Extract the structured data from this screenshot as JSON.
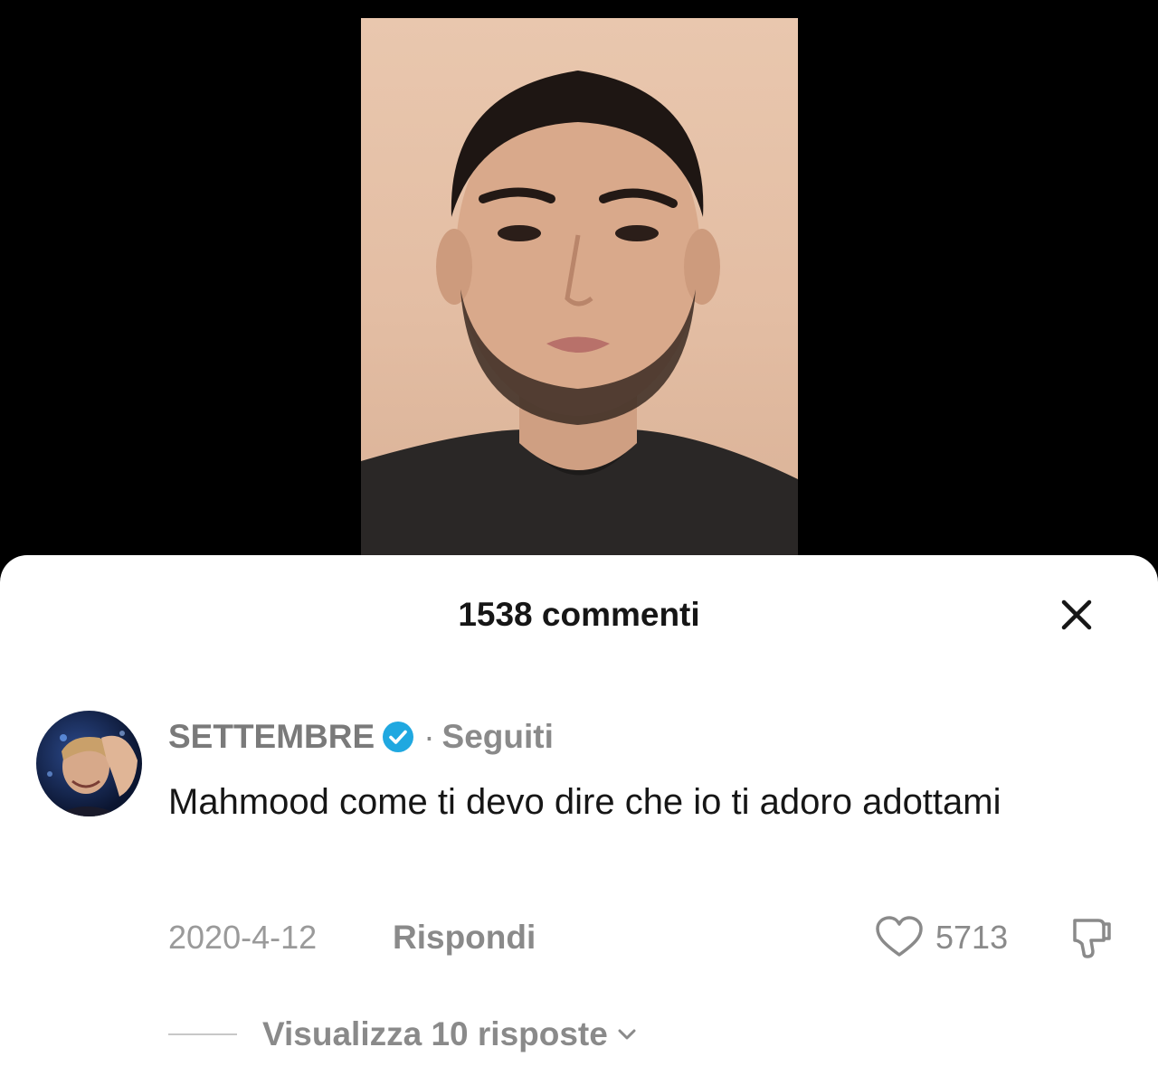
{
  "header": {
    "comments_title": "1538 commenti"
  },
  "comment": {
    "username": "SETTEMBRE",
    "separator": "·",
    "follow_status": "Seguiti",
    "text": "Mahmood come ti devo dire che io ti adoro adottami",
    "date": "2020-4-12",
    "reply_label": "Rispondi",
    "like_count": "5713"
  },
  "replies": {
    "view_label": "Visualizza 10 risposte"
  },
  "icons": {
    "close": "close-icon",
    "verified": "verified-badge-icon",
    "like": "heart-icon",
    "dislike": "thumbs-down-icon",
    "expand": "chevron-down-icon"
  },
  "colors": {
    "sheet_background": "#ffffff",
    "video_background": "#000000",
    "verified_blue": "#20a8e0",
    "muted_text": "#8a8a8a",
    "primary_text": "#161616"
  }
}
